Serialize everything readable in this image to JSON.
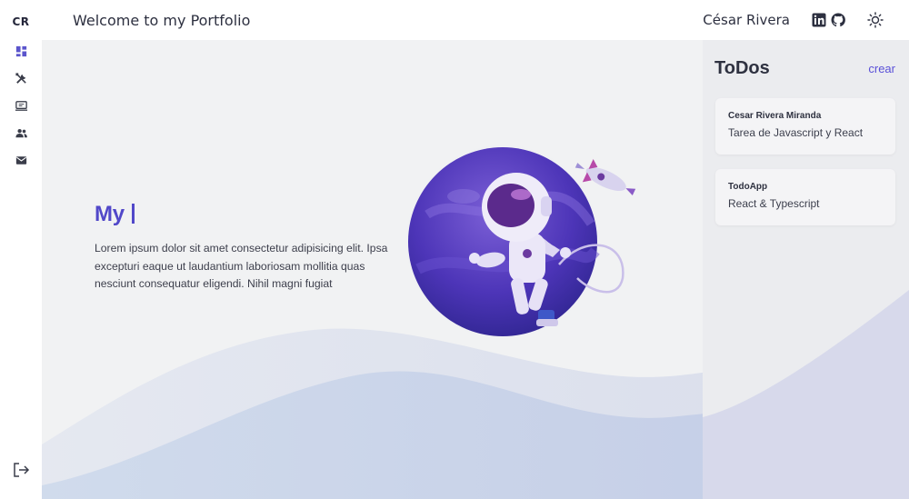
{
  "sidebar": {
    "logo": "CR",
    "items": [
      {
        "icon": "dashboard-icon"
      },
      {
        "icon": "tools-icon"
      },
      {
        "icon": "monitor-icon"
      },
      {
        "icon": "users-icon"
      },
      {
        "icon": "mail-icon"
      }
    ],
    "logout_icon": "logout-icon"
  },
  "header": {
    "title": "Welcome to my Portfolio",
    "user_name": "César Rivera",
    "social_icons": [
      "linkedin-icon",
      "github-icon"
    ],
    "theme_icon": "sun-icon"
  },
  "hero": {
    "title": "My",
    "text": "Lorem ipsum dolor sit amet consectetur adipisicing elit. Ipsa excepturi eaque ut laudantium laboriosam mollitia quas nesciunt consequatur eligendi. Nihil magni fugiat"
  },
  "todos": {
    "title": "ToDos",
    "add_label": "crear",
    "items": [
      {
        "author": "Cesar Rivera Miranda",
        "description": "Tarea de Javascript y React"
      },
      {
        "author": "TodoApp",
        "description": "React & Typescript"
      }
    ]
  },
  "colors": {
    "accent": "#5148c9",
    "background": "#f1f2f3",
    "panel": "#ebecef",
    "wave": "#c9d3ea"
  }
}
